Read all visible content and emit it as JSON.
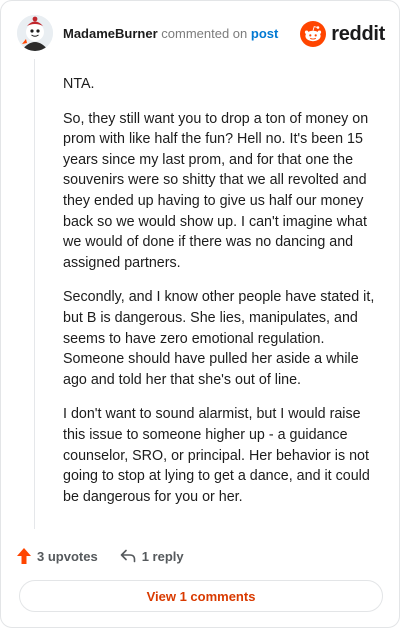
{
  "comment": {
    "username": "MadameBurner",
    "action_text": "commented on",
    "target_link": "post",
    "brand": "reddit",
    "paragraphs": [
      "NTA.",
      "So, they still want you to drop a ton of money on prom with like half the fun? Hell no. It's been 15 years since my last prom, and for that one the souvenirs were so shitty that we all revolted and they ended up having to give us half our money back so we would show up. I can't imagine what we would of done if there was no dancing and assigned partners.",
      "Secondly, and I know other people have stated it, but B is dangerous. She lies, manipulates, and seems to have zero emotional regulation. Someone should have pulled her aside a while ago and told her that she's out of line.",
      "I don't want to sound alarmist, but I would raise this issue to someone higher up - a guidance counselor, SRO, or principal. Her behavior is not going to stop at lying to get a dance, and it could be dangerous for you or her."
    ],
    "upvotes_label": "3 upvotes",
    "reply_label": "1 reply",
    "view_comments_label": "View 1 comments"
  },
  "icons": {
    "upvote": "upvote-arrow-icon",
    "reply": "reply-arrow-icon",
    "brand": "reddit-snoo-icon"
  },
  "colors": {
    "accent": "#ff4500",
    "link": "#0079d3",
    "view_comments": "#d93a00",
    "muted": "#55595c"
  }
}
